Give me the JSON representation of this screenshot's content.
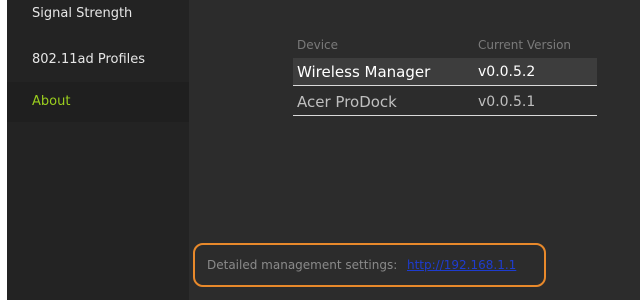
{
  "sidebar": {
    "items": [
      {
        "label": "Signal Strength",
        "selected": false
      },
      {
        "label": "802.11ad Profiles",
        "selected": false
      },
      {
        "label": "About",
        "selected": true
      }
    ]
  },
  "about": {
    "columns": {
      "device": "Device",
      "version": "Current Version"
    },
    "rows": [
      {
        "device": "Wireless Manager",
        "version": "v0.0.5.2",
        "highlighted": true
      },
      {
        "device": "Acer ProDock",
        "version": "v0.0.5.1",
        "highlighted": false
      }
    ],
    "management": {
      "label": "Detailed management settings:",
      "link": "http://192.168.1.1"
    }
  },
  "colors": {
    "accent": "#9acd1e",
    "background": "#2c2c2c",
    "sidebar": "#232323",
    "highlight_box": "#e8892b",
    "link": "#1e3ccf"
  }
}
